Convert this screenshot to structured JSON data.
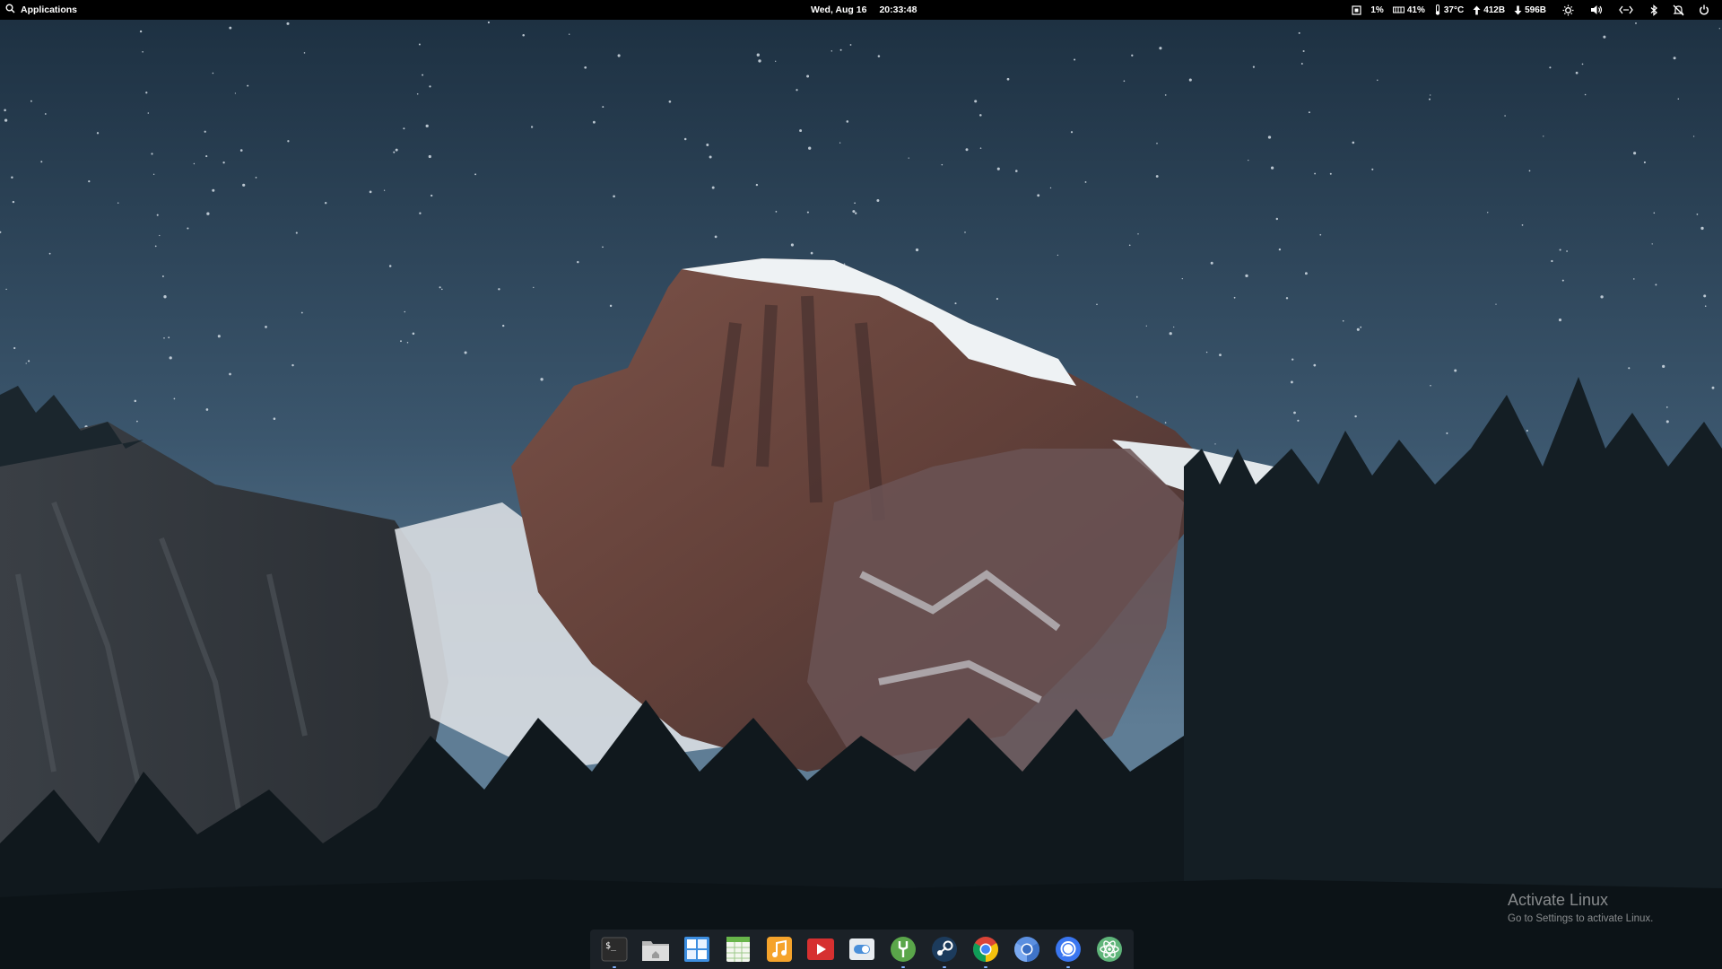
{
  "panel": {
    "applications_label": "Applications",
    "date": "Wed, Aug 16",
    "time": "20:33:48",
    "cpu": "1%",
    "memory": "41%",
    "temperature": "37°C",
    "upload": "412B",
    "download": "596B",
    "icons": [
      "search-icon",
      "cpu-icon",
      "memory-icon",
      "thermometer-icon",
      "upload-arrow-icon",
      "download-arrow-icon",
      "brightness-icon",
      "volume-icon",
      "network-icon",
      "bluetooth-icon",
      "notifications-off-icon",
      "power-icon"
    ]
  },
  "watermark": {
    "title": "Activate Linux",
    "subtitle": "Go to Settings to activate Linux."
  },
  "dock": {
    "items": [
      {
        "name": "Terminal",
        "icon": "terminal-icon",
        "running": true
      },
      {
        "name": "Files",
        "icon": "files-icon",
        "running": false
      },
      {
        "name": "App Center",
        "icon": "appcenter-icon",
        "running": false
      },
      {
        "name": "Spreadsheet",
        "icon": "spreadsheet-icon",
        "running": false
      },
      {
        "name": "Music",
        "icon": "music-icon",
        "running": false
      },
      {
        "name": "Videos",
        "icon": "video-player-icon",
        "running": false
      },
      {
        "name": "Settings",
        "icon": "settings-toggle-icon",
        "running": false
      },
      {
        "name": "Tweaks",
        "icon": "tweaks-icon",
        "running": true
      },
      {
        "name": "Steam",
        "icon": "steam-icon",
        "running": true
      },
      {
        "name": "Google Chrome",
        "icon": "chrome-icon",
        "running": true
      },
      {
        "name": "Chromium",
        "icon": "chromium-icon",
        "running": false
      },
      {
        "name": "Signal",
        "icon": "signal-icon",
        "running": true
      },
      {
        "name": "Atom",
        "icon": "atom-icon",
        "running": false
      }
    ]
  },
  "colors": {
    "panel_bg": "#000000",
    "sky_top": "#1f3446",
    "sky_bottom": "#5f7f99",
    "rock": "#6e4a43",
    "snow": "#e8ecef",
    "trees": "#101a1f",
    "dock_bg": "#2a3036"
  }
}
